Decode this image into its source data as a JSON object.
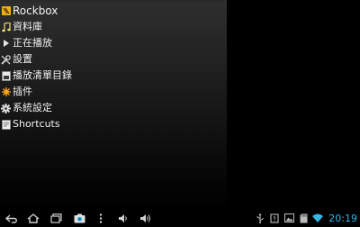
{
  "menu": {
    "partial_header": "...",
    "items": [
      {
        "label": "Rockbox",
        "icon": "rockbox-logo-icon"
      },
      {
        "label": "資料庫",
        "icon": "music-note-icon"
      },
      {
        "label": "正在播放",
        "icon": "play-icon"
      },
      {
        "label": "設置",
        "icon": "tools-icon"
      },
      {
        "label": "播放清單目錄",
        "icon": "playlist-icon"
      },
      {
        "label": "插件",
        "icon": "plugin-icon"
      },
      {
        "label": "系統設定",
        "icon": "gear-icon"
      },
      {
        "label": "Shortcuts",
        "icon": "shortcuts-icon"
      }
    ]
  },
  "navbar": {
    "buttons": [
      {
        "icon": "back-icon"
      },
      {
        "icon": "home-icon"
      },
      {
        "icon": "recent-apps-icon"
      },
      {
        "icon": "screenshot-icon"
      },
      {
        "icon": "menu-dots-icon"
      },
      {
        "icon": "volume-down-icon"
      },
      {
        "icon": "volume-up-icon"
      }
    ],
    "status": {
      "time": "20:19",
      "icons": [
        "usb-icon",
        "notification-icon",
        "image-icon",
        "sd-card-icon",
        "wifi-icon"
      ]
    }
  },
  "colors": {
    "accent": "#33b5e5",
    "rockbox_orange": "#f3b10a",
    "plugin_orange": "#ffa31a",
    "note_yellow": "#f0e070"
  }
}
